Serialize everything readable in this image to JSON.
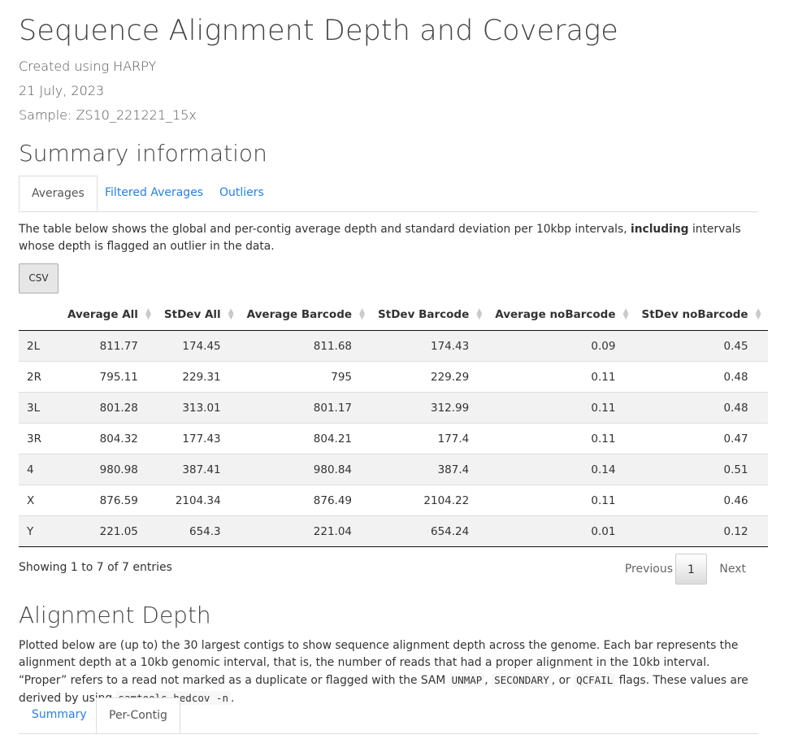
{
  "report": {
    "title": "Sequence Alignment Depth and Coverage",
    "created": "Created using HARPY",
    "date": "21 July, 2023",
    "sample": "Sample: ZS10_221221_15x"
  },
  "summary": {
    "heading": "Summary information",
    "tabs": [
      {
        "label": "Averages",
        "active": true
      },
      {
        "label": "Filtered Averages",
        "active": false
      },
      {
        "label": "Outliers",
        "active": false
      }
    ],
    "desc_pre": "The table below shows the global and per-contig average depth and standard deviation per 10kbp intervals, ",
    "desc_bold": "including",
    "desc_post": " intervals whose depth is flagged an outlier in the data.",
    "csv_label": "CSV",
    "columns": [
      "",
      "Average All",
      "StDev All",
      "Average Barcode",
      "StDev Barcode",
      "Average noBarcode",
      "StDev noBarcode"
    ],
    "rows": [
      [
        "2L",
        "811.77",
        "174.45",
        "811.68",
        "174.43",
        "0.09",
        "0.45"
      ],
      [
        "2R",
        "795.11",
        "229.31",
        "795",
        "229.29",
        "0.11",
        "0.48"
      ],
      [
        "3L",
        "801.28",
        "313.01",
        "801.17",
        "312.99",
        "0.11",
        "0.48"
      ],
      [
        "3R",
        "804.32",
        "177.43",
        "804.21",
        "177.4",
        "0.11",
        "0.47"
      ],
      [
        "4",
        "980.98",
        "387.41",
        "980.84",
        "387.4",
        "0.14",
        "0.51"
      ],
      [
        "X",
        "876.59",
        "2104.34",
        "876.49",
        "2104.22",
        "0.11",
        "0.46"
      ],
      [
        "Y",
        "221.05",
        "654.3",
        "221.04",
        "654.24",
        "0.01",
        "0.12"
      ]
    ],
    "info": "Showing 1 to 7 of 7 entries",
    "pagination": {
      "previous": "Previous",
      "current": "1",
      "next": "Next"
    }
  },
  "depth": {
    "heading": "Alignment Depth",
    "desc_a": "Plotted below are (up to) the 30 largest contigs to show sequence alignment depth across the genome. Each bar represents the alignment depth at a 10kb genomic interval, that is, the number of reads that had a proper alignment in the 10kb interval. “Proper” refers to a read not marked as a duplicate or flagged with the SAM ",
    "code1": "UNMAP",
    "sep1": ", ",
    "code2": "SECONDARY",
    "sep2": ", or ",
    "code3": "QCFAIL",
    "desc_b": " flags. These values are derived by using ",
    "code4": "samtools bedcov -n",
    "desc_c": ".",
    "tabs": [
      {
        "label": "Summary",
        "active": false
      },
      {
        "label": "Per-Contig",
        "active": true
      }
    ]
  },
  "colors": {
    "link": "#2780e3",
    "text": "#333333",
    "stripe": "#f2f2f2"
  }
}
